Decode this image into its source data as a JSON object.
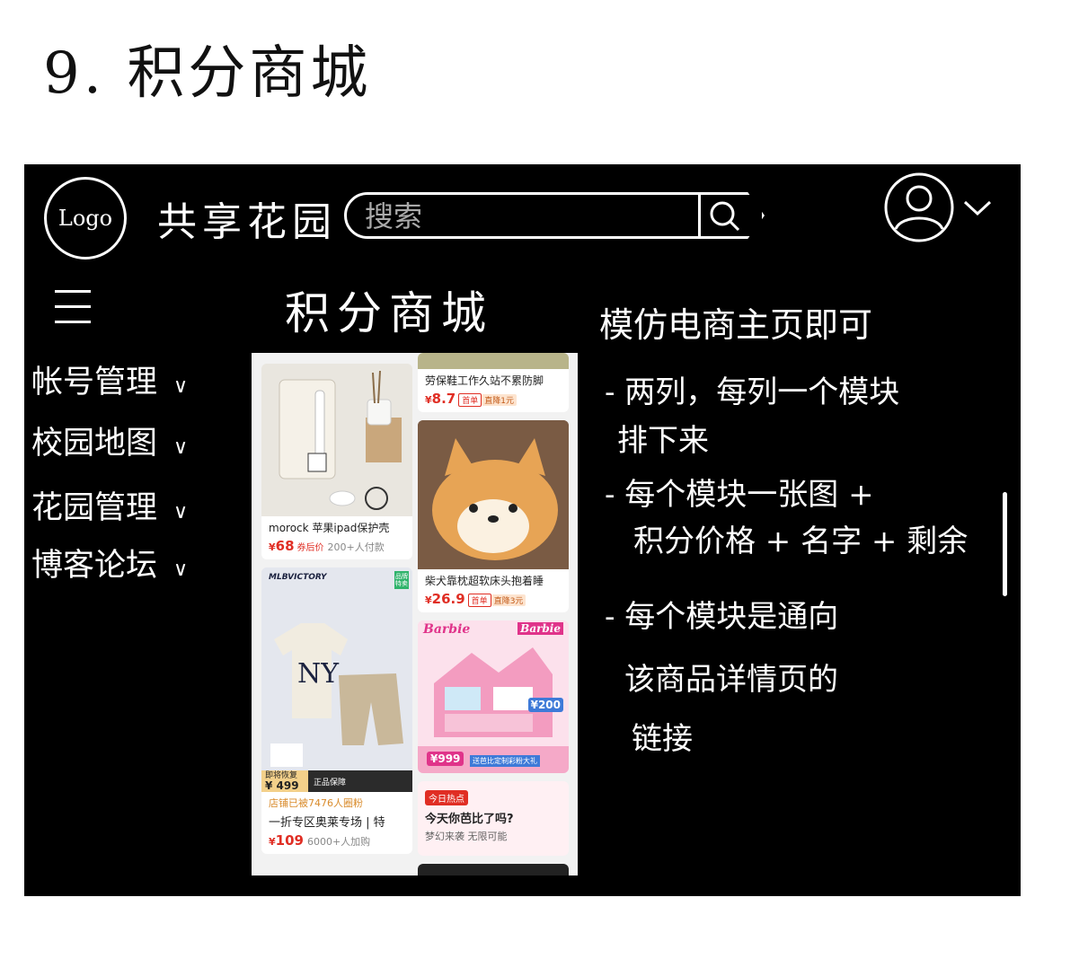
{
  "page_heading": "9. 积分商城",
  "header": {
    "logo_text": "Logo",
    "site_title": "共享花园",
    "search_placeholder": "搜索",
    "search_icon": "search-icon",
    "user_icon": "user-avatar-icon",
    "menu_chevron_icon": "chevron-down-icon"
  },
  "sidebar": {
    "menu_icon": "hamburger-icon",
    "items": [
      {
        "label": "帐号管理",
        "chevron": "∨"
      },
      {
        "label": "校园地图",
        "chevron": "∨"
      },
      {
        "label": "花园管理",
        "chevron": "∨"
      },
      {
        "label": "博客论坛",
        "chevron": "∨"
      }
    ]
  },
  "main": {
    "title": "积分商城",
    "products_left": [
      {
        "name": "morock 苹果ipad保护壳",
        "price": "68",
        "price_tag": "券后价",
        "sold": "200+人付款"
      },
      {
        "mini_badge": "品牌特卖",
        "brand": "MLBVICTORY",
        "promo_label": "即将恢复",
        "promo_price": "499",
        "promo_note": "正品保障",
        "shop_note": "店铺已被7476人圈粉",
        "name": "一折专区奥莱专场 | 特",
        "price": "109",
        "sold": "6000+人加购"
      }
    ],
    "products_right": [
      {
        "name": "劳保鞋工作久站不累防脚",
        "price": "8.7",
        "tag1": "首单",
        "tag2": "直降1元"
      },
      {
        "name": "柴犬靠枕超软床头抱着睡",
        "price": "26.9",
        "tag1": "首单",
        "tag2": "直降3元"
      },
      {
        "brand": "Barbie",
        "offer": "200",
        "price_badge": "999",
        "banner": "送芭比定制彩粉大礼"
      },
      {
        "badge": "今日热点",
        "title": "今天你芭比了吗?",
        "subtitle": "梦幻来袭 无限可能"
      }
    ]
  },
  "notes": {
    "title": "模仿电商主页即可",
    "lines": [
      "- 两列，每列一个模块",
      "排下来",
      "- 每个模块一张图 +",
      "积分价格 + 名字 + 剩余",
      "- 每个模块是通向",
      "该商品详情页的",
      "链接"
    ]
  },
  "colors": {
    "board": "#000000",
    "price_red": "#e02e24",
    "text": "#ffffff"
  }
}
